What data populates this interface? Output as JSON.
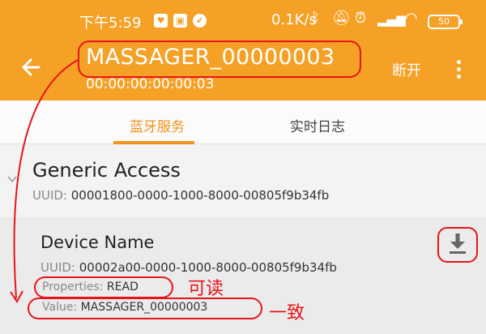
{
  "status_bar": {
    "time": "下午5:59",
    "network_speed": "0.1K/s",
    "battery": "50",
    "icons": [
      "heart-icon",
      "gallery-icon",
      "shield-icon",
      "bluetooth-icon",
      "mute-icon",
      "alarm-icon",
      "hd-signal-icon",
      "wifi-icon",
      "battery-icon"
    ]
  },
  "app_bar": {
    "title": "MASSAGER_00000003",
    "subtitle": "00:00:00:00:00:03",
    "disconnect_label": "断开",
    "bg_color": "#f5a126"
  },
  "tabs": [
    {
      "label": "蓝牙服务",
      "active": true
    },
    {
      "label": "实时日志",
      "active": false
    }
  ],
  "service": {
    "name": "Generic Access",
    "uuid_label": "UUID: ",
    "uuid": "00001800-0000-1000-8000-00805f9b34fb"
  },
  "characteristic": {
    "name": "Device Name",
    "uuid_label": "UUID: ",
    "uuid": "00002a00-0000-1000-8000-00805f9b34fb",
    "properties_label": "Properties: ",
    "properties": "READ",
    "value_label": "Value: ",
    "value": "MASSAGER_00000003"
  },
  "annotations": {
    "readable_note": "可读",
    "consistent_note": "一致",
    "color": "#e8141a"
  }
}
